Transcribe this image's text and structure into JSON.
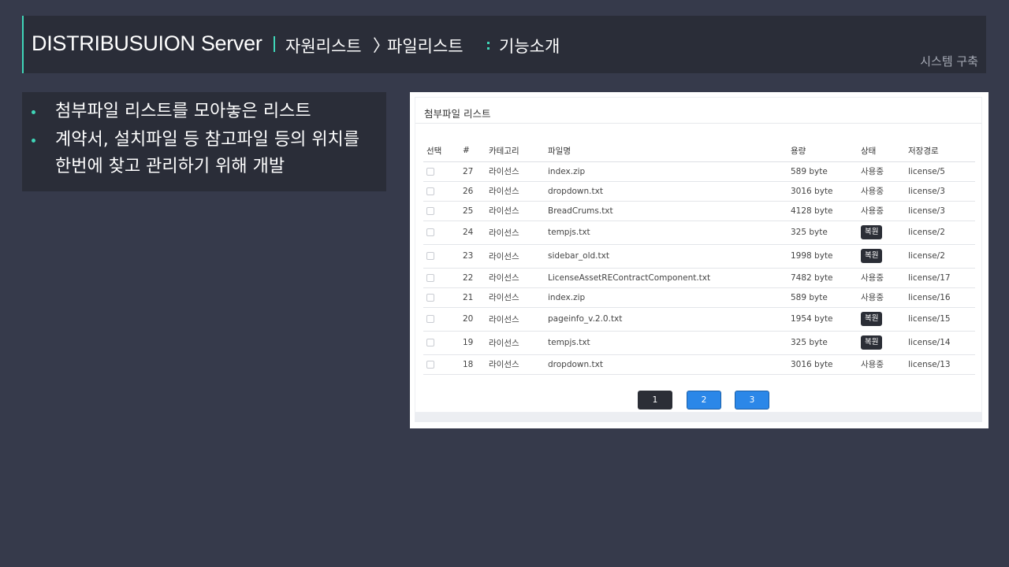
{
  "header": {
    "app_title": "DISTRIBUSUION Server",
    "crumb1": "자원리스트",
    "chevron": "〉",
    "crumb2": "파일리스트",
    "crumb3": "기능소개",
    "subtitle": "시스템 구축",
    "accent_color": "#3fd6b8"
  },
  "description": {
    "items": [
      "첨부파일 리스트를 모아놓은 리스트",
      "계약서, 설치파일 등 참고파일 등의 위치를",
      "한번에 찾고 관리하기 위해 개발"
    ]
  },
  "panel": {
    "title": "첨부파일 리스트",
    "columns": [
      "선택",
      "#",
      "카테고리",
      "파일명",
      "용량",
      "상태",
      "저장경로"
    ],
    "rows": [
      {
        "no": "27",
        "category": "라이선스",
        "filename": "index.zip",
        "size": "589 byte",
        "status": "사용중",
        "path": "license/5",
        "restore": false
      },
      {
        "no": "26",
        "category": "라이선스",
        "filename": "dropdown.txt",
        "size": "3016 byte",
        "status": "사용중",
        "path": "license/3",
        "restore": false
      },
      {
        "no": "25",
        "category": "라이선스",
        "filename": "BreadCrums.txt",
        "size": "4128 byte",
        "status": "사용중",
        "path": "license/3",
        "restore": false
      },
      {
        "no": "24",
        "category": "라이선스",
        "filename": "tempjs.txt",
        "size": "325 byte",
        "status": "복원",
        "path": "license/2",
        "restore": true
      },
      {
        "no": "23",
        "category": "라이선스",
        "filename": "sidebar_old.txt",
        "size": "1998 byte",
        "status": "복원",
        "path": "license/2",
        "restore": true
      },
      {
        "no": "22",
        "category": "라이선스",
        "filename": "LicenseAssetREContractComponent.txt",
        "size": "7482 byte",
        "status": "사용중",
        "path": "license/17",
        "restore": false
      },
      {
        "no": "21",
        "category": "라이선스",
        "filename": "index.zip",
        "size": "589 byte",
        "status": "사용중",
        "path": "license/16",
        "restore": false
      },
      {
        "no": "20",
        "category": "라이선스",
        "filename": "pageinfo_v.2.0.txt",
        "size": "1954 byte",
        "status": "복원",
        "path": "license/15",
        "restore": true
      },
      {
        "no": "19",
        "category": "라이선스",
        "filename": "tempjs.txt",
        "size": "325 byte",
        "status": "복원",
        "path": "license/14",
        "restore": true
      },
      {
        "no": "18",
        "category": "라이선스",
        "filename": "dropdown.txt",
        "size": "3016 byte",
        "status": "사용중",
        "path": "license/13",
        "restore": false
      }
    ],
    "pages": [
      "1",
      "2",
      "3"
    ],
    "active_page": "1"
  }
}
